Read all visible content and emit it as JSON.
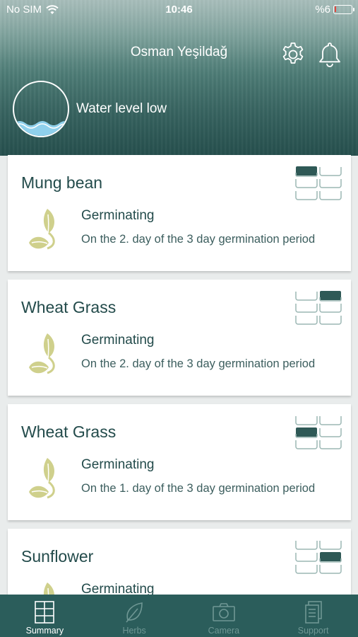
{
  "status_bar": {
    "carrier": "No SIM",
    "time": "10:46",
    "battery": "%6"
  },
  "header": {
    "user_name": "Osman Yeşildağ",
    "settings_icon": "gear-icon",
    "notifications_icon": "bell-icon"
  },
  "water": {
    "label": "Water level low",
    "icon": "water-level-icon"
  },
  "cards": [
    {
      "title": "Mung bean",
      "status": "Germinating",
      "description": "On the 2. day of the 3 day germination period",
      "slot": 0
    },
    {
      "title": "Wheat Grass",
      "status": "Germinating",
      "description": "On the 2. day of the 3 day germination period",
      "slot": 1
    },
    {
      "title": "Wheat Grass",
      "status": "Germinating",
      "description": "On the 1. day of the 3 day germination period",
      "slot": 2
    },
    {
      "title": "Sunflower",
      "status": "Germinating",
      "description": "",
      "slot": 3
    }
  ],
  "tabs": [
    {
      "label": "Summary",
      "icon": "summary-icon",
      "active": true
    },
    {
      "label": "Herbs",
      "icon": "leaf-icon",
      "active": false
    },
    {
      "label": "Camera",
      "icon": "camera-icon",
      "active": false
    },
    {
      "label": "Support",
      "icon": "support-icon",
      "active": false
    }
  ],
  "colors": {
    "primary": "#2b5d5b",
    "sprout": "#cfd08c",
    "text": "#234b4b",
    "slot_active": "#2f5956"
  }
}
